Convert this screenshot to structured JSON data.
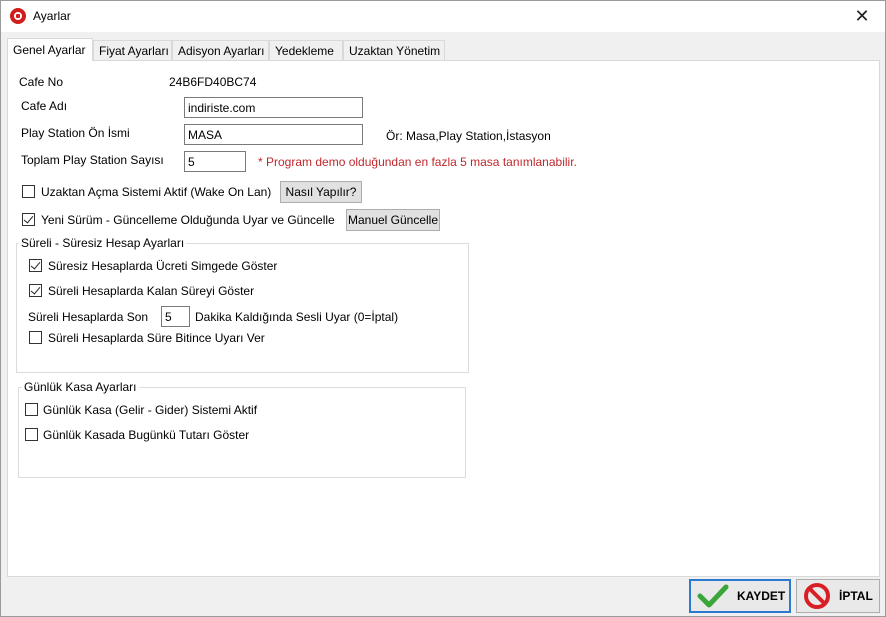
{
  "window": {
    "title": "Ayarlar",
    "close": "✕"
  },
  "tabs": [
    {
      "label": "Genel Ayarlar"
    },
    {
      "label": "Fiyat Ayarları"
    },
    {
      "label": "Adisyon Ayarları"
    },
    {
      "label": "Yedekleme"
    },
    {
      "label": "Uzaktan Yönetim"
    }
  ],
  "general": {
    "cafe_no_label": "Cafe No",
    "cafe_no_value": "24B6FD40BC74",
    "cafe_name_label": "Cafe Adı",
    "cafe_name_value": "indiriste.com",
    "ps_prefix_label": "Play Station Ön İsmi",
    "ps_prefix_value": "MASA",
    "ps_prefix_hint": "Ör: Masa,Play Station,İstasyon",
    "ps_count_label": "Toplam Play Station Sayısı",
    "ps_count_value": "5",
    "demo_note": "* Program demo olduğundan en fazla 5 masa tanımlanabilir.",
    "wol_label": "Uzaktan Açma Sistemi Aktif (Wake On Lan)",
    "wol_checked": false,
    "howto_button": "Nasıl Yapılır?",
    "update_label": "Yeni Sürüm - Güncelleme Olduğunda Uyar ve Güncelle",
    "update_checked": true,
    "manual_update_button": "Manuel Güncelle"
  },
  "timed_group": {
    "title": "Süreli - Süresiz Hesap Ayarları",
    "show_fee_label": "Süresiz Hesaplarda Ücreti Simgede Göster",
    "show_fee_checked": true,
    "show_remaining_label": "Süreli Hesaplarda Kalan Süreyi Göster",
    "show_remaining_checked": true,
    "warn_prefix": "Süreli Hesaplarda Son",
    "warn_minutes": "5",
    "warn_suffix": "Dakika Kaldığında Sesli Uyar (0=İptal)",
    "end_warn_label": "Süreli Hesaplarda Süre Bitince Uyarı Ver",
    "end_warn_checked": false
  },
  "cash_group": {
    "title": "Günlük Kasa Ayarları",
    "cash_system_label": "Günlük Kasa (Gelir - Gider) Sistemi Aktif",
    "cash_system_checked": false,
    "show_today_label": "Günlük Kasada Bugünkü Tutarı Göster",
    "show_today_checked": false
  },
  "footer": {
    "save_label": "KAYDET",
    "cancel_label": "İPTAL",
    "save_color": "#3aa63a",
    "cancel_color": "#d91f26"
  }
}
